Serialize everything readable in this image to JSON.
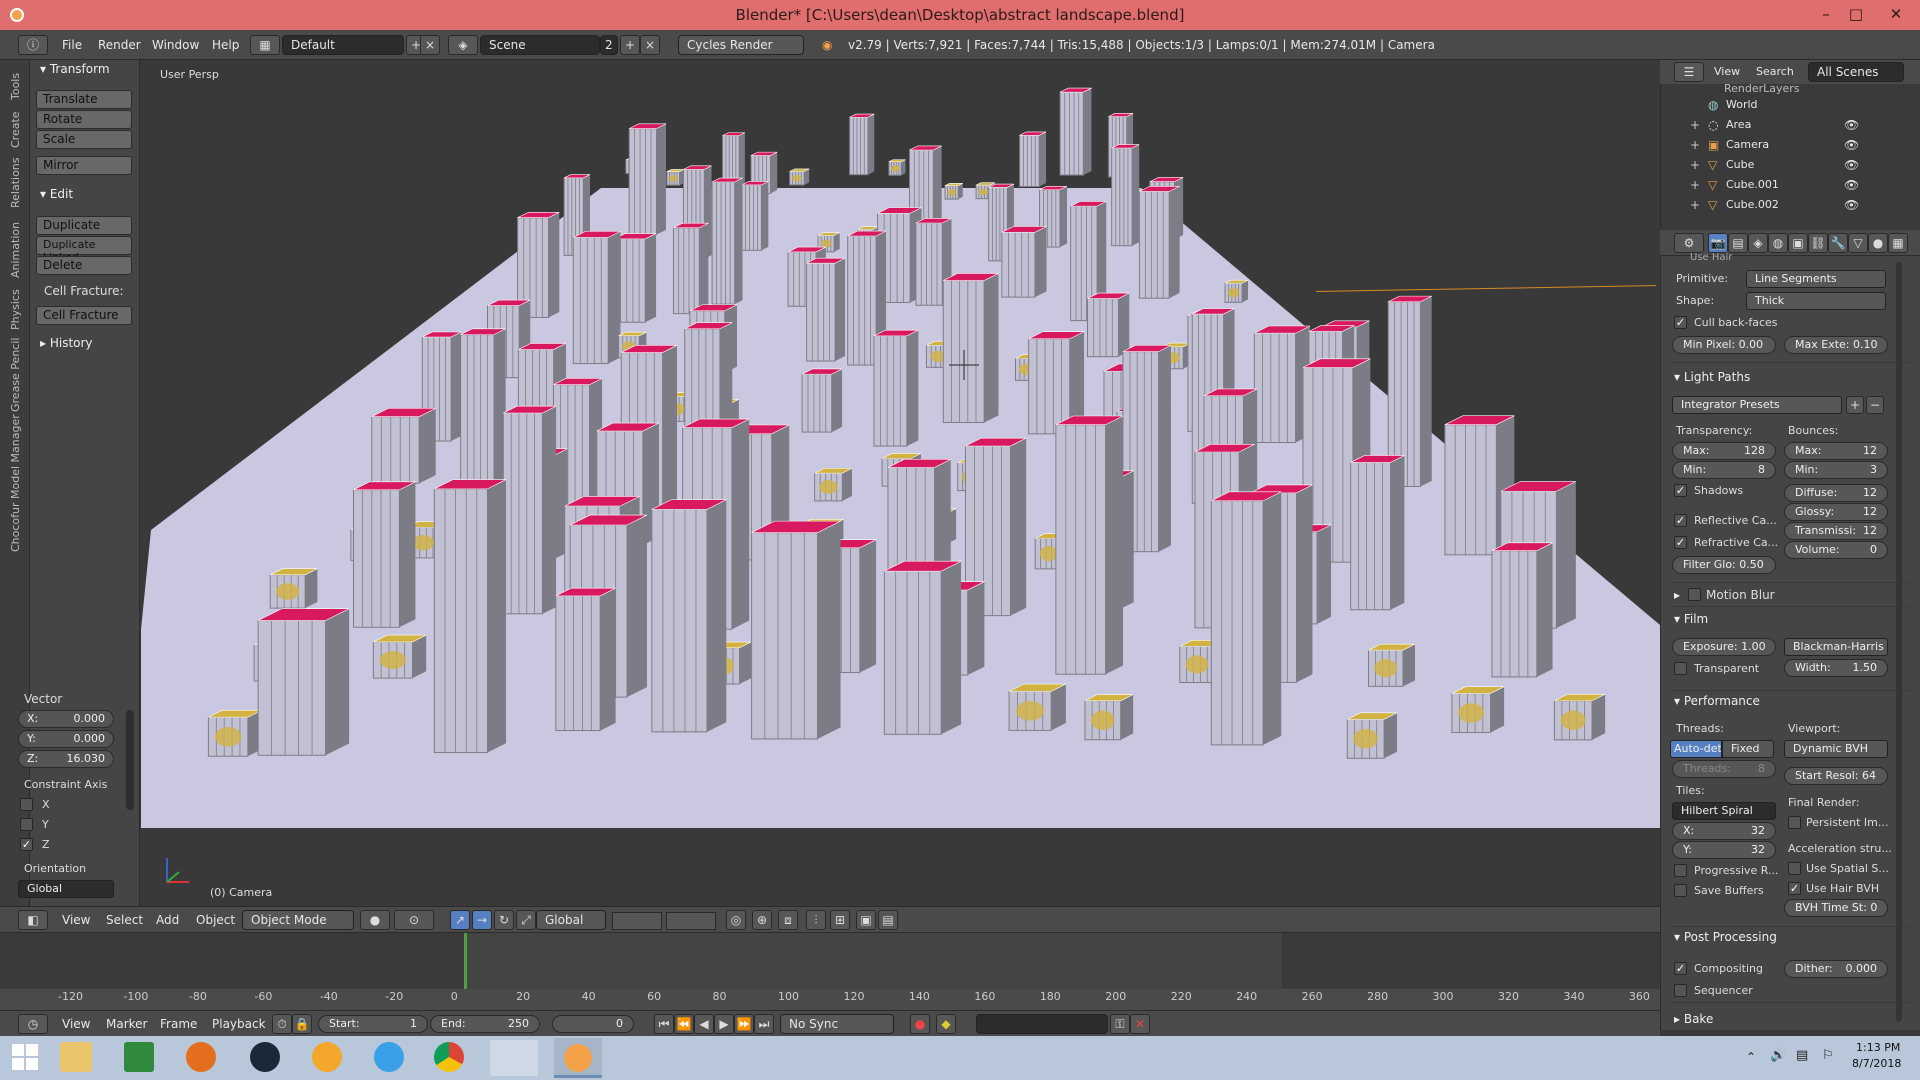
{
  "window": {
    "title": "Blender* [C:\\Users\\dean\\Desktop\\abstract landscape.blend]",
    "minimize_glyph": "–",
    "maximize_glyph": "□",
    "close_glyph": "✕"
  },
  "info_header": {
    "menus": [
      "File",
      "Render",
      "Window",
      "Help"
    ],
    "layout": "Default",
    "scene": "Scene",
    "scene_users": "2",
    "render_engine": "Cycles Render",
    "stats": "v2.79 | Verts:7,921 | Faces:7,744 | Tris:15,488 | Objects:1/3 | Lamps:0/1 | Mem:274.01M | Camera"
  },
  "tool_tabs": [
    "Tools",
    "Create",
    "Relations",
    "Animation",
    "Physics",
    "Grease Pencil",
    "Chocofur Model Manager"
  ],
  "tool_shelf": {
    "transform_title": "Transform",
    "translate": "Translate",
    "rotate": "Rotate",
    "scale": "Scale",
    "mirror": "Mirror",
    "edit_title": "Edit",
    "duplicate": "Duplicate",
    "duplicate_linked": "Duplicate Linked",
    "delete": "Delete",
    "cell_fracture_label": "Cell Fracture:",
    "cell_fracture_btn": "Cell Fracture",
    "history_title": "History",
    "vector_title": "Vector",
    "x": "X:",
    "x_val": "0.000",
    "y": "Y:",
    "y_val": "0.000",
    "z": "Z:",
    "z_val": "16.030",
    "constraint_axis": "Constraint Axis",
    "axis_x": "X",
    "axis_y": "Y",
    "axis_z": "Z",
    "orientation": "Orientation",
    "orientation_val": "Global"
  },
  "viewport": {
    "view_name": "User Persp",
    "object_label": "(0) Camera",
    "colors": {
      "ground": "#c9c8e0",
      "building": "#c2c1d3",
      "building_shade": "#7c7c86",
      "roof": "#d8195f",
      "gold": "#d2b341",
      "bg": "#393939"
    }
  },
  "viewport_header": {
    "menus": [
      "View",
      "Select",
      "Add",
      "Object"
    ],
    "mode": "Object Mode",
    "orientation": "Global"
  },
  "outliner": {
    "menus": [
      "View",
      "Search"
    ],
    "filter": "All Scenes",
    "rows": [
      "RenderLayers",
      "World",
      "Area",
      "Camera",
      "Cube",
      "Cube.001",
      "Cube.002"
    ]
  },
  "properties": {
    "use_hair": "Use Hair",
    "primitive_label": "Primitive:",
    "primitive": "Line Segments",
    "shape_label": "Shape:",
    "shape": "Thick",
    "cull": "Cull back-faces",
    "min_pixel": "Min Pixel: 0.00",
    "max_ext": "Max Exte: 0.10",
    "light_paths": "Light Paths",
    "integrator": "Integrator Presets",
    "transparency": "Transparency:",
    "bounces": "Bounces:",
    "t_max": "Max:",
    "t_max_v": "128",
    "t_min": "Min:",
    "t_min_v": "8",
    "b_max": "Max:",
    "b_max_v": "12",
    "b_min": "Min:",
    "b_min_v": "3",
    "shadows": "Shadows",
    "diffuse": "Diffuse:",
    "diffuse_v": "12",
    "glossy": "Glossy:",
    "glossy_v": "12",
    "reflective": "Reflective Ca...",
    "transmissi": "Transmissi:",
    "transmissi_v": "12",
    "refractive": "Refractive Ca...",
    "volume": "Volume:",
    "volume_v": "0",
    "filter_glo": "Filter Glo: 0.50",
    "motion_blur": "Motion Blur",
    "film": "Film",
    "exposure": "Exposure: 1.00",
    "filter": "Blackman-Harris",
    "transparent": "Transparent",
    "width": "Width:",
    "width_v": "1.50",
    "performance": "Performance",
    "threads": "Threads:",
    "auto_detect": "Auto-dete",
    "fixed": "Fixed",
    "threads_v": "Threads:",
    "threads_n": "8",
    "viewport_lbl": "Viewport:",
    "bvh": "Dynamic BVH",
    "start_resol": "Start Resol: 64",
    "tiles": "Tiles:",
    "hilbert": "Hilbert Spiral",
    "final_render": "Final Render:",
    "persistent": "Persistent Im...",
    "tx": "X:",
    "tx_v": "32",
    "ty": "Y:",
    "ty_v": "32",
    "accel": "Acceleration stru...",
    "progressive": "Progressive R...",
    "spatial": "Use Spatial S...",
    "save_buffers": "Save Buffers",
    "use_hair_bvh": "Use Hair BVH",
    "bvh_time": "BVH Time St: 0",
    "post_processing": "Post Processing",
    "compositing": "Compositing",
    "dither": "Dither:",
    "dither_v": "0.000",
    "sequencer": "Sequencer",
    "bake": "Bake"
  },
  "timeline": {
    "ticks": [
      "-120",
      "-100",
      "-80",
      "-60",
      "-40",
      "-20",
      "0",
      "20",
      "40",
      "60",
      "80",
      "100",
      "120",
      "140",
      "160",
      "180",
      "200",
      "220",
      "240",
      "260",
      "280",
      "300",
      "320",
      "340",
      "360"
    ],
    "menus": [
      "View",
      "Marker",
      "Frame",
      "Playback"
    ],
    "start": "Start:",
    "start_v": "1",
    "end": "End:",
    "end_v": "250",
    "current": "0",
    "sync": "No Sync"
  },
  "taskbar": {
    "time": "1:13 PM",
    "date": "8/7/2018"
  }
}
